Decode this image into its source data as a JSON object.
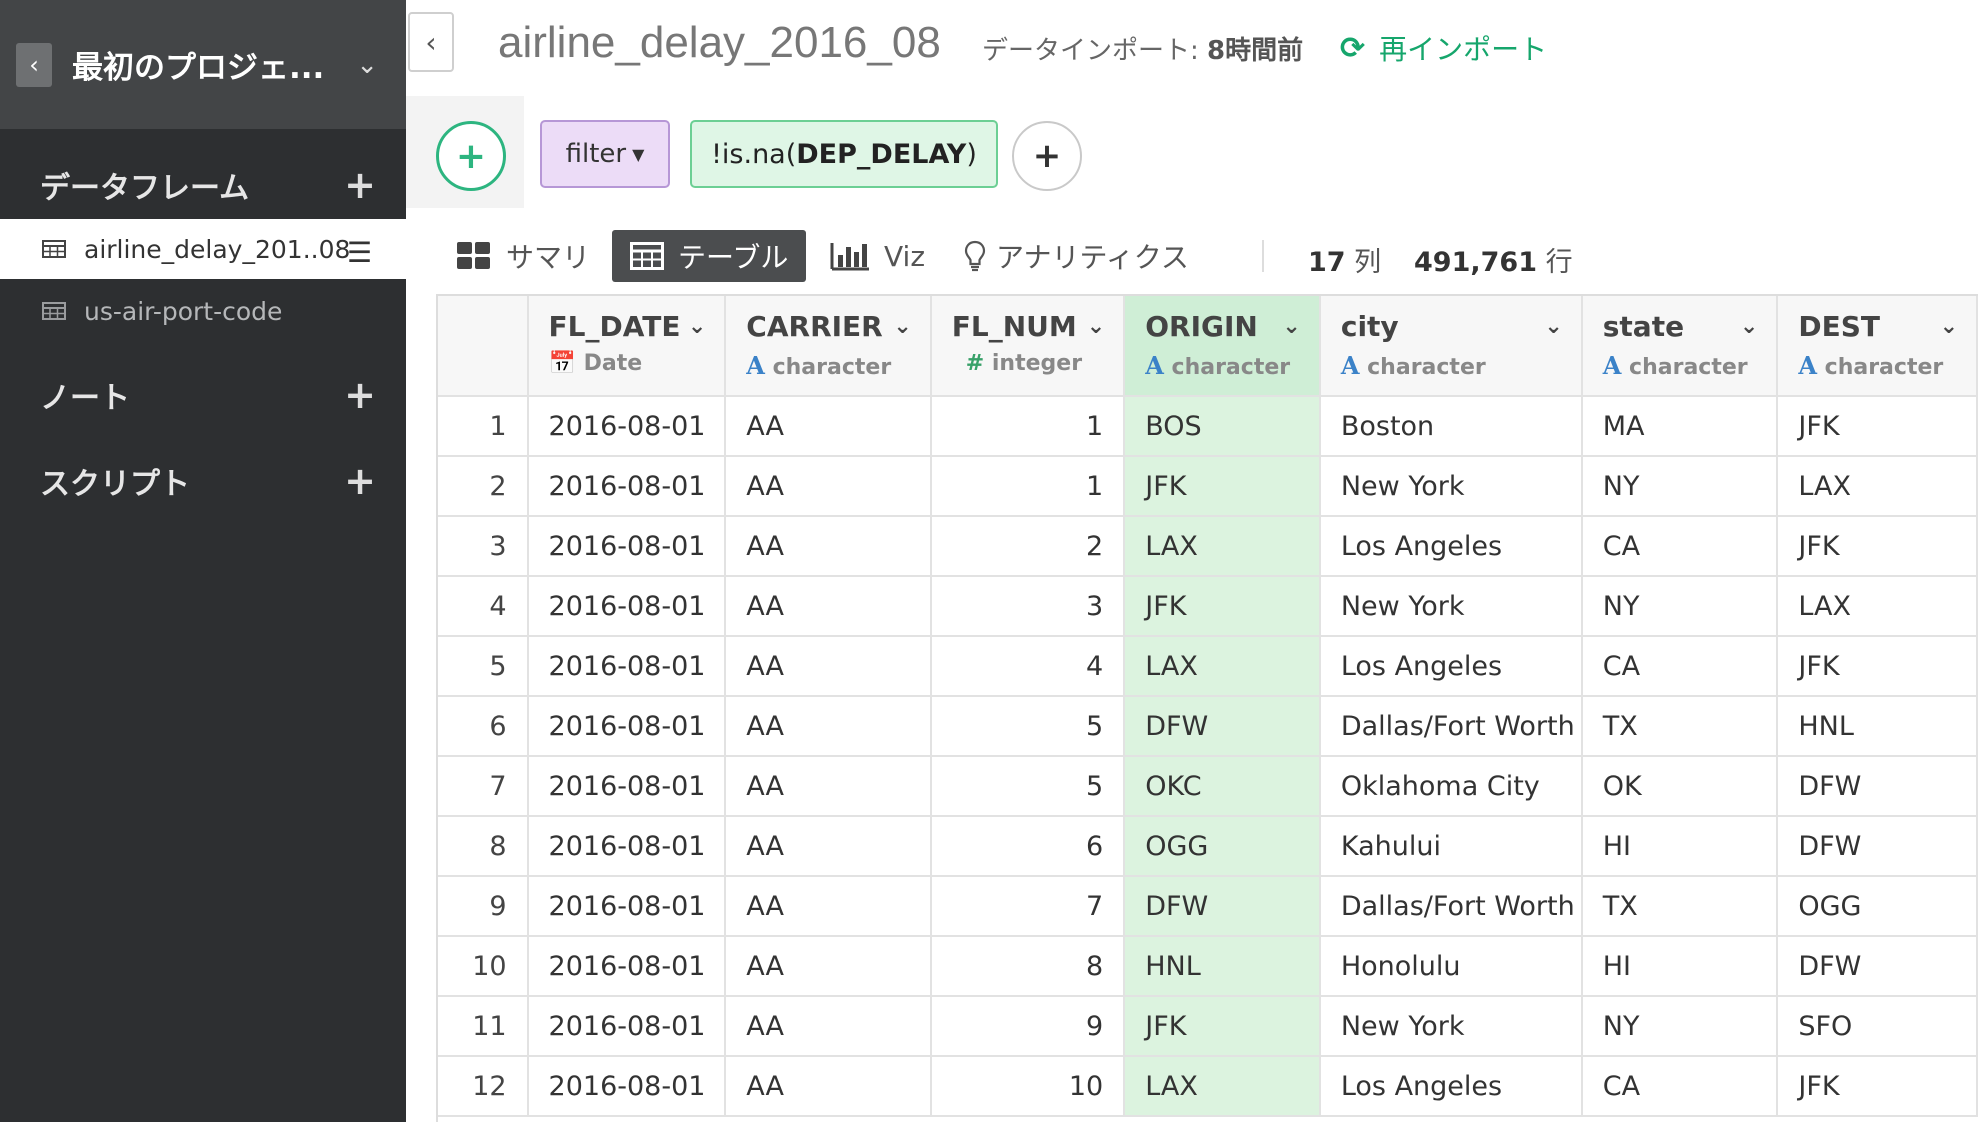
{
  "sidebar": {
    "project_title": "最初のプロジェ...",
    "dataframes_label": "データフレーム",
    "dataframes": [
      {
        "label": "airline_delay_201..08",
        "active": true
      },
      {
        "label": "us-air-port-code",
        "active": false
      }
    ],
    "notes_label": "ノート",
    "scripts_label": "スクリプト"
  },
  "topbar": {
    "title": "airline_delay_2016_08",
    "import_prefix": "データインポート: ",
    "import_time": "8時間前",
    "reimport_label": "再インポート",
    "accent": "#16a66c"
  },
  "step": {
    "command": "filter",
    "expr_prefix": "!is.na(",
    "expr_column": "DEP_DELAY",
    "expr_suffix": ")"
  },
  "tabs": [
    {
      "label": "サマリ",
      "icon": "grid-icon"
    },
    {
      "label": "テーブル",
      "icon": "table-icon",
      "active": true
    },
    {
      "label": "Viz",
      "icon": "bar-chart-icon"
    },
    {
      "label": "アナリティクス",
      "icon": "lightbulb-icon"
    }
  ],
  "counts": {
    "columns_value": "17",
    "columns_unit": "列",
    "rows_value": "491,761",
    "rows_unit": "行"
  },
  "table": {
    "columns": [
      {
        "name": "FL_DATE",
        "type": "Date",
        "type_icon": "calendar-icon"
      },
      {
        "name": "CARRIER",
        "type": "character",
        "type_icon": "A"
      },
      {
        "name": "FL_NUM",
        "type": "integer",
        "type_icon": "#"
      },
      {
        "name": "ORIGIN",
        "type": "character",
        "type_icon": "A",
        "highlighted": true
      },
      {
        "name": "city",
        "type": "character",
        "type_icon": "A"
      },
      {
        "name": "state",
        "type": "character",
        "type_icon": "A"
      },
      {
        "name": "DEST",
        "type": "character",
        "type_icon": "A"
      }
    ],
    "rows": [
      [
        "1",
        "2016-08-01",
        "AA",
        "1",
        "BOS",
        "Boston",
        "MA",
        "JFK"
      ],
      [
        "2",
        "2016-08-01",
        "AA",
        "1",
        "JFK",
        "New York",
        "NY",
        "LAX"
      ],
      [
        "3",
        "2016-08-01",
        "AA",
        "2",
        "LAX",
        "Los Angeles",
        "CA",
        "JFK"
      ],
      [
        "4",
        "2016-08-01",
        "AA",
        "3",
        "JFK",
        "New York",
        "NY",
        "LAX"
      ],
      [
        "5",
        "2016-08-01",
        "AA",
        "4",
        "LAX",
        "Los Angeles",
        "CA",
        "JFK"
      ],
      [
        "6",
        "2016-08-01",
        "AA",
        "5",
        "DFW",
        "Dallas/Fort Worth",
        "TX",
        "HNL"
      ],
      [
        "7",
        "2016-08-01",
        "AA",
        "5",
        "OKC",
        "Oklahoma City",
        "OK",
        "DFW"
      ],
      [
        "8",
        "2016-08-01",
        "AA",
        "6",
        "OGG",
        "Kahului",
        "HI",
        "DFW"
      ],
      [
        "9",
        "2016-08-01",
        "AA",
        "7",
        "DFW",
        "Dallas/Fort Worth",
        "TX",
        "OGG"
      ],
      [
        "10",
        "2016-08-01",
        "AA",
        "8",
        "HNL",
        "Honolulu",
        "HI",
        "DFW"
      ],
      [
        "11",
        "2016-08-01",
        "AA",
        "9",
        "JFK",
        "New York",
        "NY",
        "SFO"
      ],
      [
        "12",
        "2016-08-01",
        "AA",
        "10",
        "LAX",
        "Los Angeles",
        "CA",
        "JFK"
      ]
    ]
  }
}
